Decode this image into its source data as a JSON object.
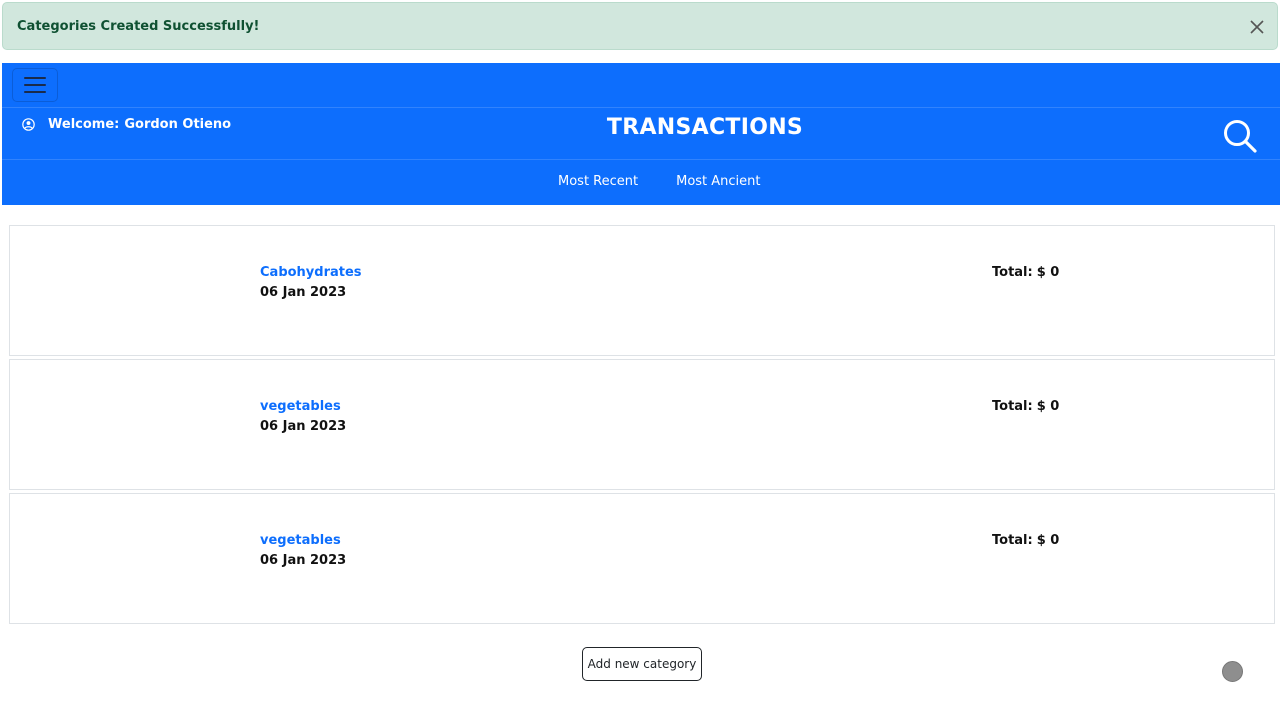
{
  "alert": {
    "message": "Categories Created Successfully!"
  },
  "header": {
    "welcome_label": "Welcome:",
    "user_name": "Gordon Otieno",
    "title": "TRANSACTIONS",
    "sort_options": [
      "Most Recent",
      "Most Ancient"
    ]
  },
  "categories": [
    {
      "name": "Cabohydrates",
      "date": "06 Jan 2023",
      "total_label": "Total:",
      "total_value": "$ 0"
    },
    {
      "name": "vegetables",
      "date": "06 Jan 2023",
      "total_label": "Total:",
      "total_value": "$ 0"
    },
    {
      "name": "vegetables",
      "date": "06 Jan 2023",
      "total_label": "Total:",
      "total_value": "$ 0"
    }
  ],
  "actions": {
    "add_category_label": "Add new category"
  },
  "colors": {
    "primary": "#0d6efd",
    "success_bg": "#d1e7dd",
    "success_text": "#0f5132"
  },
  "icons": [
    "close-icon",
    "hamburger-icon",
    "user-circle-icon",
    "search-icon"
  ]
}
